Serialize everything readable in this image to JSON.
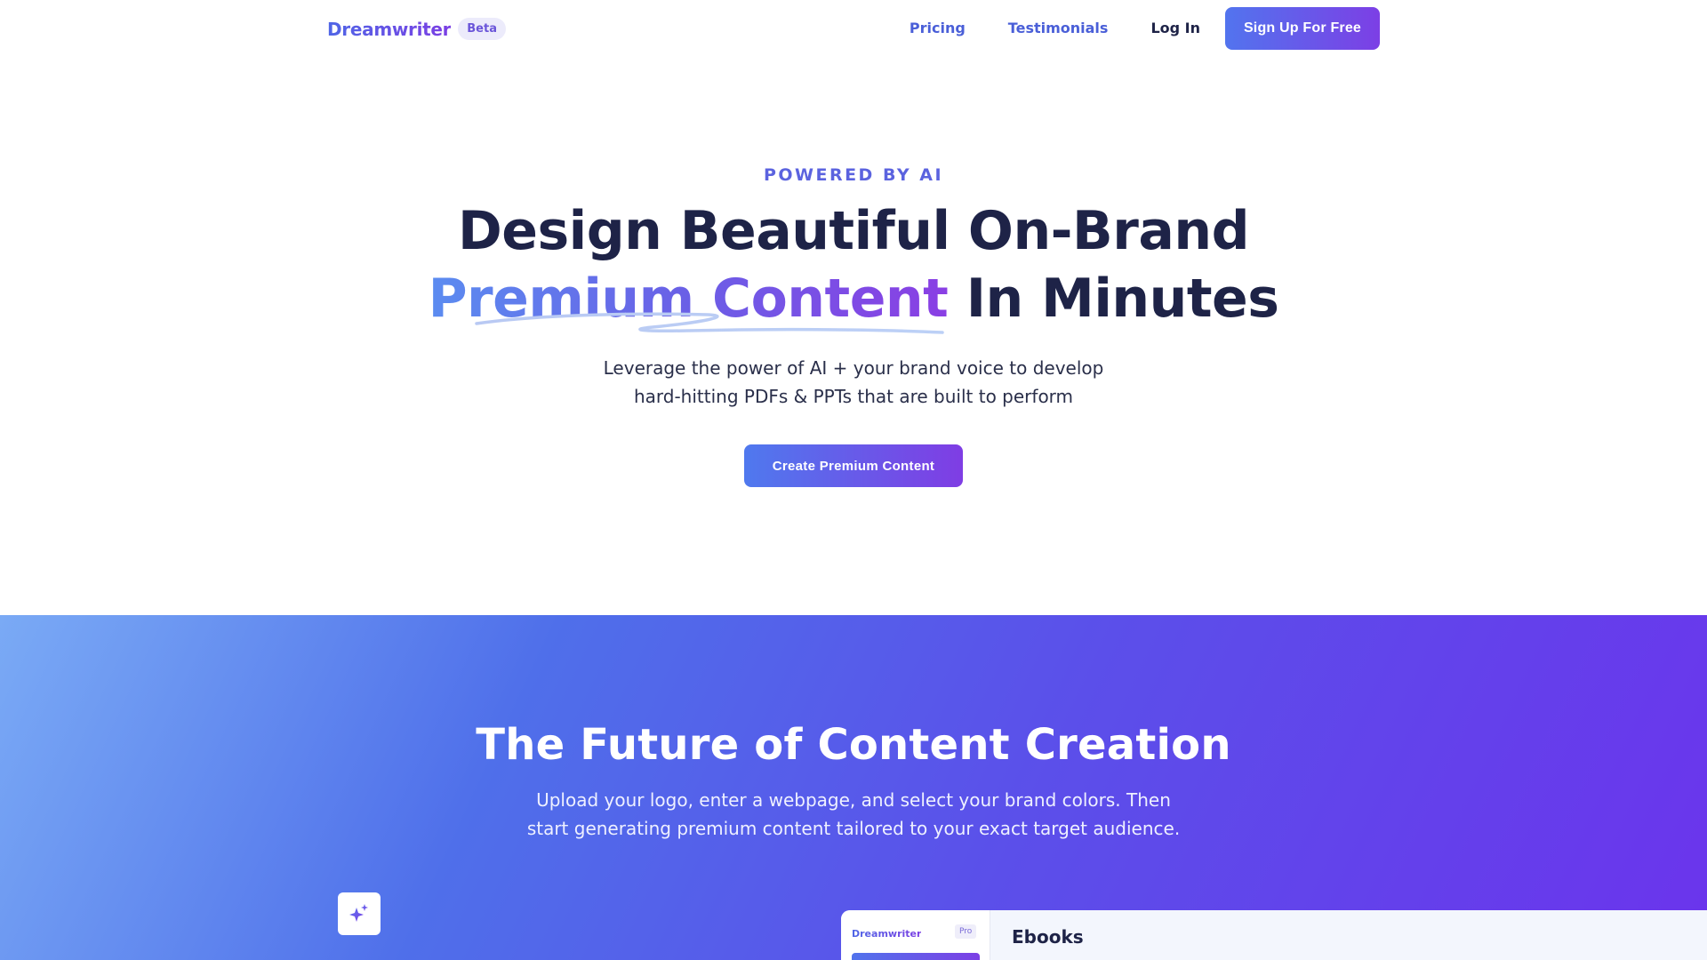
{
  "header": {
    "brand": "Dreamwriter",
    "badge": "Beta",
    "nav": {
      "pricing": "Pricing",
      "testimonials": "Testimonials",
      "login": "Log In",
      "signup": "Sign Up For Free"
    }
  },
  "hero": {
    "eyebrow": "POWERED BY AI",
    "title_line1": "Design Beautiful On-Brand",
    "title_highlight": "Premium Content",
    "title_rest": "In Minutes",
    "subtitle_line1": "Leverage the power of AI + your brand voice to develop",
    "subtitle_line2": "hard-hitting PDFs & PPTs that are built to perform",
    "cta": "Create Premium Content"
  },
  "feature": {
    "title": "The Future of Content Creation",
    "subtitle_line1": "Upload your logo, enter a webpage, and select your brand colors. Then",
    "subtitle_line2": "start generating premium content tailored to your exact target audience.",
    "icon": "sparkles-icon",
    "preview": {
      "brand": "Dreamwriter",
      "badge": "Pro",
      "heading": "Ebooks"
    }
  },
  "colors": {
    "accent": "#5b63df",
    "gradient_start": "#4f79ee",
    "gradient_end": "#7f3de4",
    "text_dark": "#1e2347"
  }
}
